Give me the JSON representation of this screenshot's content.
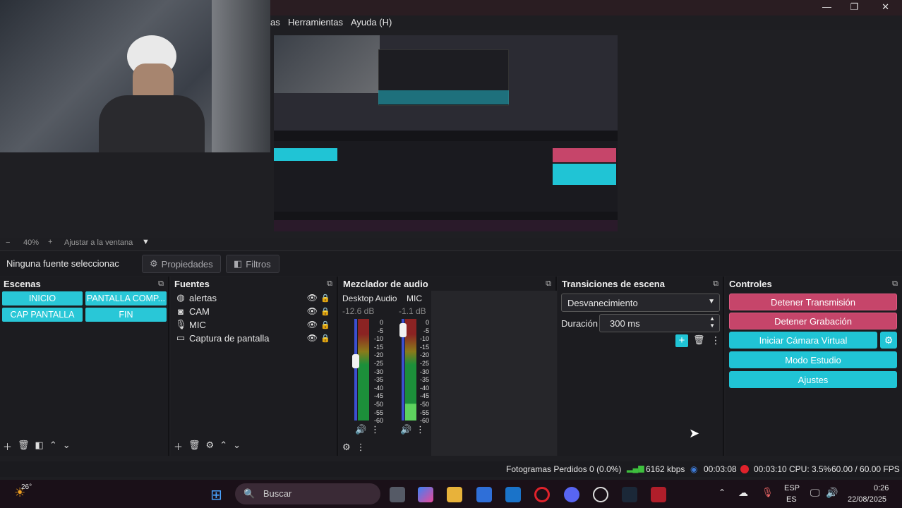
{
  "menu": {
    "items": [
      "as",
      "Herramientas",
      "Ayuda (H)"
    ]
  },
  "window_controls": {
    "minimize": "—",
    "restore": "❐",
    "close": "✕"
  },
  "zoom": {
    "minus": "−",
    "level": "40%",
    "plus": "+",
    "fit_label": "Ajustar a la ventana"
  },
  "source_bar": {
    "no_source": "Ninguna fuente seleccionac",
    "properties": "Propiedades",
    "filters": "Filtros"
  },
  "scenes": {
    "title": "Escenas",
    "items": [
      "INICIO",
      "PANTALLA COMP...",
      "CAP PANTALLA",
      "FIN"
    ]
  },
  "sources": {
    "title": "Fuentes",
    "items": [
      {
        "label": "alertas",
        "icon": "globe-icon"
      },
      {
        "label": "CAM",
        "icon": "camera-icon"
      },
      {
        "label": "MIC",
        "icon": "microphone-icon"
      },
      {
        "label": "Captura de pantalla",
        "icon": "monitor-icon"
      }
    ]
  },
  "mixer": {
    "title": "Mezclador de audio",
    "channels": [
      {
        "name": "Desktop Audio",
        "db": "-12.6 dB",
        "level": 0.7
      },
      {
        "name": "MIC",
        "db": "-1.1 dB",
        "level": 0.15
      }
    ],
    "scale": [
      "0",
      "-5",
      "-10",
      "-15",
      "-20",
      "-25",
      "-30",
      "-35",
      "-40",
      "-45",
      "-50",
      "-55",
      "-60"
    ]
  },
  "transitions": {
    "title": "Transiciones de escena",
    "selected": "Desvanecimiento",
    "duration_label": "Duración",
    "duration_value": "300 ms"
  },
  "controls": {
    "title": "Controles",
    "stop_stream": "Detener Transmisión",
    "stop_record": "Detener Grabación",
    "virtual_cam": "Iniciar Cámara Virtual",
    "studio_mode": "Modo Estudio",
    "settings": "Ajustes"
  },
  "status": {
    "dropped_frames": "Fotogramas Perdidos 0 (0.0%)",
    "bitrate": "6162 kbps",
    "stream_time": "00:03:08",
    "record_time": "00:03:10",
    "cpu": "CPU: 3.5%",
    "fps": "60.00 / 60.00 FPS"
  },
  "taskbar": {
    "weather_temp": "26°",
    "search_placeholder": "Buscar",
    "lang_top": "ESP",
    "lang_bottom": "ES",
    "time": "0:26",
    "date": "22/08/2025"
  },
  "colors": {
    "accent_cyan": "#20c4d5",
    "accent_pink": "#c6456a",
    "record_red": "#e0222b"
  }
}
